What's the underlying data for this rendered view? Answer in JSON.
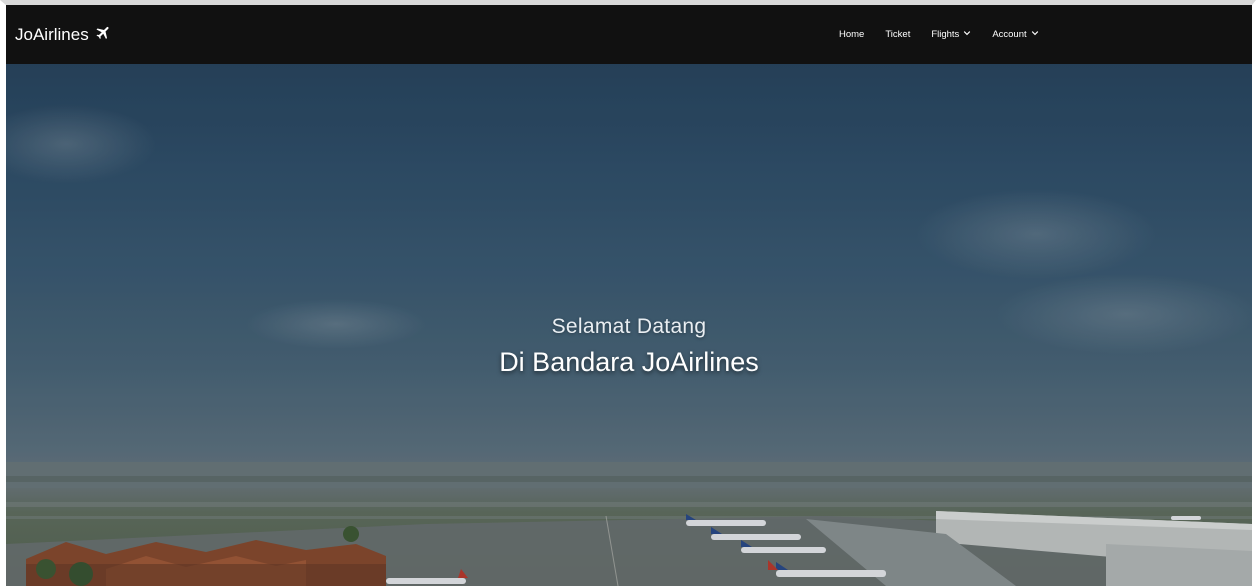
{
  "navbar": {
    "brand": "JoAirlines",
    "brand_icon": "plane-icon",
    "links": [
      {
        "label": "Home",
        "has_dropdown": false
      },
      {
        "label": "Ticket",
        "has_dropdown": false
      },
      {
        "label": "Flights",
        "has_dropdown": true
      },
      {
        "label": "Account",
        "has_dropdown": true
      }
    ]
  },
  "hero": {
    "subtitle": "Selamat Datang",
    "title": "Di Bandara JoAirlines"
  },
  "colors": {
    "navbar_bg": "#111111",
    "nav_text": "#ffffff",
    "hero_sky": "#2f4f69",
    "hero_text": "#ffffff"
  }
}
